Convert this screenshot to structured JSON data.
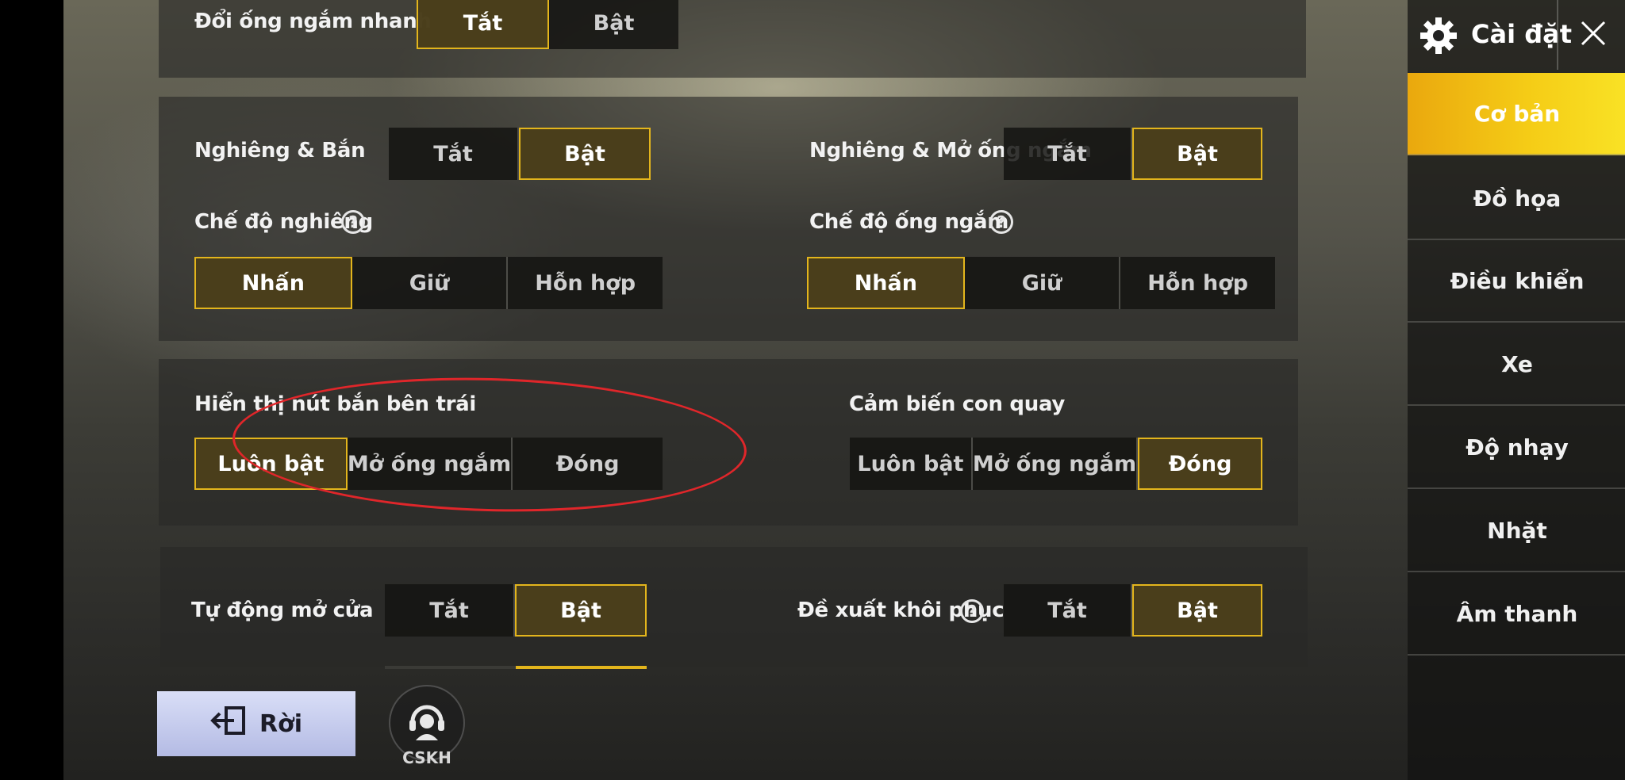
{
  "settings": {
    "quick_scope": {
      "label": "Đổi ống ngắm nhanh",
      "options": [
        "Tắt",
        "Bật"
      ],
      "selected": "Tắt"
    },
    "peek_fire": {
      "label": "Nghiêng & Bắn",
      "options": [
        "Tắt",
        "Bật"
      ],
      "selected": "Bật"
    },
    "peek_scope": {
      "label": "Nghiêng & Mở ống ngắm",
      "options": [
        "Tắt",
        "Bật"
      ],
      "selected": "Bật"
    },
    "peek_mode": {
      "label": "Chế độ nghiêng",
      "options": [
        "Nhấn",
        "Giữ",
        "Hỗn hợp"
      ],
      "selected": "Nhấn"
    },
    "scope_mode": {
      "label": "Chế độ ống ngắm",
      "options": [
        "Nhấn",
        "Giữ",
        "Hỗn hợp"
      ],
      "selected": "Nhấn"
    },
    "left_fire": {
      "label": "Hiển thị nút bắn bên trái",
      "options": [
        "Luôn bật",
        "Mở ống ngắm",
        "Đóng"
      ],
      "selected": "Luôn bật"
    },
    "gyroscope": {
      "label": "Cảm biến con quay",
      "options": [
        "Luôn bật",
        "Mở ống ngắm",
        "Đóng"
      ],
      "selected": "Đóng"
    },
    "auto_door": {
      "label": "Tự động mở cửa",
      "options": [
        "Tắt",
        "Bật"
      ],
      "selected": "Bật"
    },
    "recovery": {
      "label": "Đề xuất khôi phục",
      "options": [
        "Tắt",
        "Bật"
      ],
      "selected": "Bật"
    },
    "help_symbol": "?"
  },
  "sidebar": {
    "title": "Cài đặt",
    "items": [
      {
        "label": "Cơ bản",
        "active": true
      },
      {
        "label": "Đồ họa",
        "active": false
      },
      {
        "label": "Điều khiển",
        "active": false
      },
      {
        "label": "Xe",
        "active": false
      },
      {
        "label": "Độ nhạy",
        "active": false
      },
      {
        "label": "Nhặt",
        "active": false
      },
      {
        "label": "Âm thanh",
        "active": false
      }
    ]
  },
  "footer": {
    "leave_label": "Rời",
    "support_label": "CSKH"
  },
  "colors": {
    "accent": "#e3b51c",
    "highlight_ring": "#e0262a"
  },
  "icons": [
    "gear-icon",
    "close-icon",
    "help-icon",
    "exit-icon",
    "headset-icon"
  ]
}
